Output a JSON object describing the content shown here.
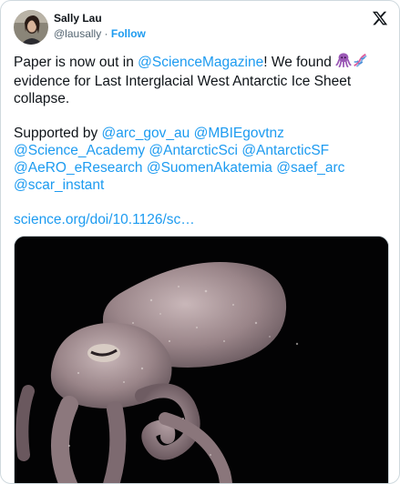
{
  "author": {
    "name": "Sally Lau",
    "handle": "@lausally",
    "separator": "·",
    "follow_label": "Follow"
  },
  "tweet": {
    "line1_a": "Paper is now out in ",
    "mention_science": "@ScienceMagazine",
    "line1_b": "! We found ",
    "emoji_names": [
      "octopus-emoji",
      "dna-emoji"
    ],
    "line1_c": " evidence for Last Interglacial West Antarctic Ice Sheet collapse.",
    "supported_by": "Supported by ",
    "mentions": [
      "@arc_gov_au",
      "@MBIEgovtnz",
      "@Science_Academy",
      "@AntarcticSci",
      "@AntarcticSF",
      "@AeRO_eResearch",
      "@SuomenAkatemia",
      "@saef_arc",
      "@scar_instant"
    ],
    "link": "science.org/doi/10.1126/sc…"
  },
  "icons": {
    "brand": "x-logo-icon"
  },
  "colors": {
    "link": "#1d9bf0",
    "text": "#0f1419",
    "muted": "#536471",
    "border": "#cfd9de"
  }
}
